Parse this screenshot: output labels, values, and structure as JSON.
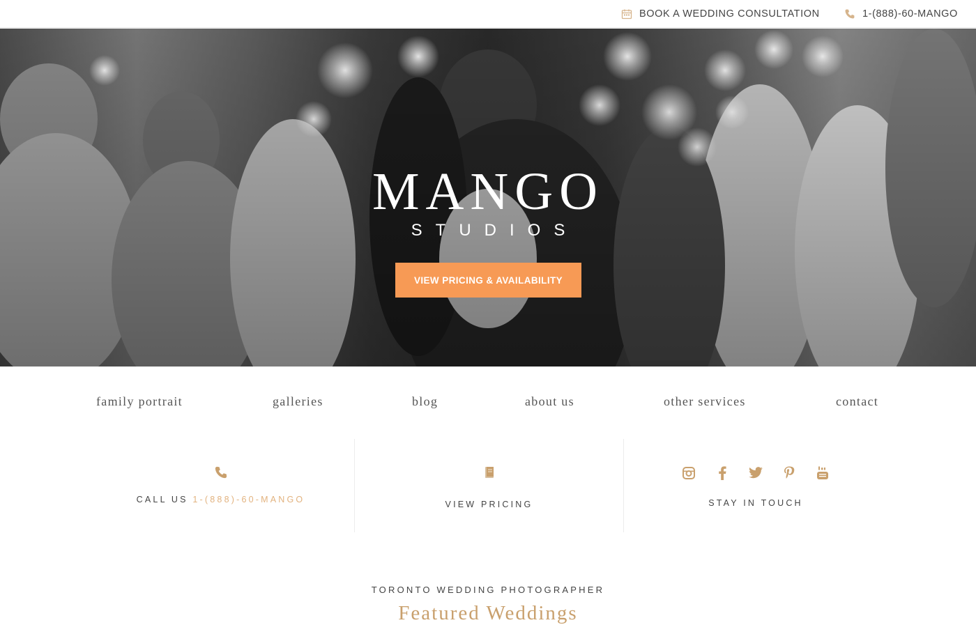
{
  "topbar": {
    "consultation_label": "BOOK A WEDDING CONSULTATION",
    "phone_label": "1-(888)-60-MANGO",
    "icons": [
      "calendar-icon",
      "phone-icon"
    ]
  },
  "hero": {
    "logo_main": "MANGO",
    "logo_sub": "STUDIOS",
    "cta_label": "VIEW PRICING & AVAILABILITY"
  },
  "nav": {
    "items": [
      {
        "label": "family portrait"
      },
      {
        "label": "galleries"
      },
      {
        "label": "blog"
      },
      {
        "label": "about us"
      },
      {
        "label": "other services"
      },
      {
        "label": "contact"
      }
    ]
  },
  "info": {
    "call_prefix": "CALL US",
    "call_number": "1-(888)-60-MANGO",
    "pricing_label": "VIEW PRICING",
    "touch_label": "STAY IN TOUCH",
    "social_icons": [
      "instagram-icon",
      "facebook-icon",
      "twitter-icon",
      "pinterest-icon",
      "youtube-icon"
    ]
  },
  "featured": {
    "eyebrow": "TORONTO WEDDING PHOTOGRAPHER",
    "title": "Featured Weddings"
  },
  "colors": {
    "accent_gold": "#c9a06d",
    "cta_orange": "#f79a55",
    "phone_gold": "#e2b27e"
  }
}
